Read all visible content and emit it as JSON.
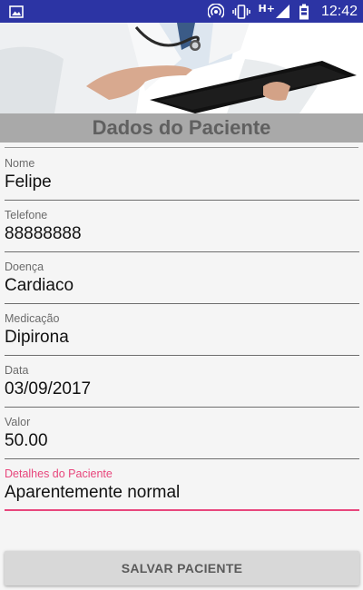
{
  "status_bar": {
    "network_label": "H+",
    "time": "12:42",
    "background_color": "#2c34a4",
    "icons": [
      "image-notification-icon",
      "hotspot-icon",
      "vibrate-icon",
      "signal-icon",
      "battery-icon"
    ]
  },
  "header": {
    "title": "Dados do Paciente",
    "banner_image": "doctor-with-tablet"
  },
  "form": {
    "fields": [
      {
        "label": "Nome",
        "value": "Felipe"
      },
      {
        "label": "Telefone",
        "value": "88888888"
      },
      {
        "label": "Doença",
        "value": "Cardiaco"
      },
      {
        "label": "Medicação",
        "value": "Dipirona"
      },
      {
        "label": "Data",
        "value": "03/09/2017"
      },
      {
        "label": "Valor",
        "value": "50.00"
      },
      {
        "label": "Detalhes do Paciente",
        "value": "Aparentemente normal",
        "focused": true
      }
    ],
    "accent_color": "#e8467c"
  },
  "actions": {
    "save_label": "SALVAR PACIENTE"
  }
}
